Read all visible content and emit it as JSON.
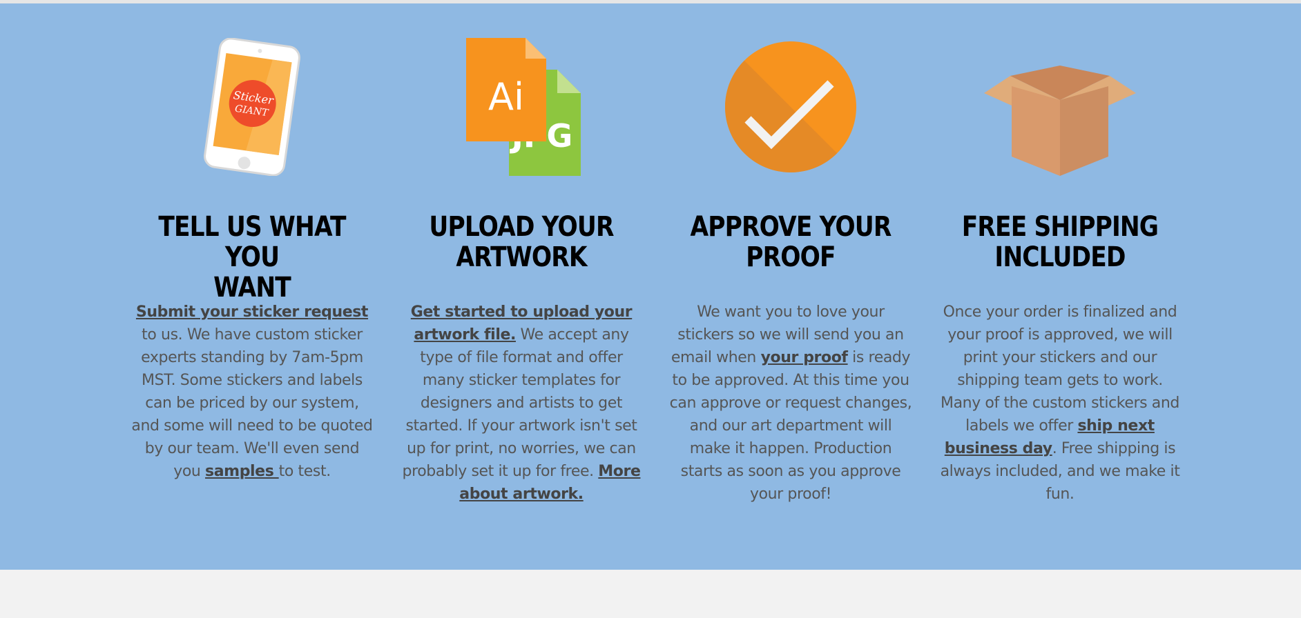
{
  "steps": [
    {
      "icon": "phone-sticker-icon",
      "icon_text": [
        "Sticker",
        "GIANT"
      ],
      "title_line1": "TELL US WHAT YOU",
      "title_line2": "WANT",
      "link1": "Submit your sticker request",
      "body1": " to us. We have custom sticker experts standing by 7am-5pm MST. Some stickers and labels can be priced by our system, and some will need to be quoted by our team. We'll even send you ",
      "link2": "samples ",
      "body2": "to test."
    },
    {
      "icon": "file-formats-icon",
      "icon_text": [
        "Ai",
        "JPG"
      ],
      "title_line1": "UPLOAD YOUR",
      "title_line2": "ARTWORK",
      "link1": "Get started to upload your artwork file.",
      "body1": " We accept any type of file format and offer many sticker templates for designers and artists to get started. If your artwork isn't set up for print, no worries, we can probably set it up for free. ",
      "link2": "More about artwork."
    },
    {
      "icon": "checkmark-circle-icon",
      "title_line1": "APPROVE YOUR",
      "title_line2": "PROOF",
      "body0": "We want you to love your stickers so we will send you an email when ",
      "link1": "your proof",
      "body1": " is ready to be approved. At this time you can approve or request changes, and our art department will make it happen. Production starts as soon as you approve your proof!"
    },
    {
      "icon": "shipping-box-icon",
      "title_line1": "FREE SHIPPING",
      "title_line2": "INCLUDED",
      "body0": "Once your order is finalized and your proof is approved, we will print your stickers and our shipping team gets to work. Many of the custom stickers and labels we offer ",
      "link1": "ship next business day",
      "body1": ". Free shipping is always included, and we make it fun."
    }
  ],
  "colors": {
    "band_background": "#8fb9e3",
    "page_background": "#f2f2f2",
    "accent_orange": "#f7931e",
    "accent_green": "#8dc63f",
    "box_tan": "#d99a6c"
  }
}
